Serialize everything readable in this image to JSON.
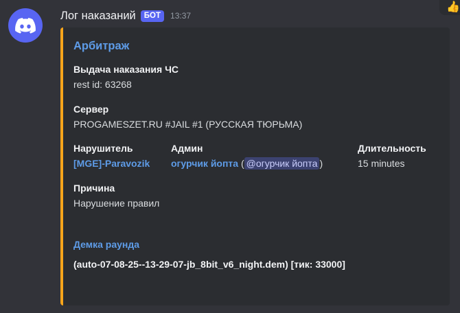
{
  "message": {
    "author": "Лог наказаний",
    "bot_tag": "БОТ",
    "timestamp": "13:37"
  },
  "reaction": {
    "emoji": "👍"
  },
  "embed": {
    "accent_color": "#f8a51b",
    "title": "Арбитраж",
    "fields": {
      "issue": {
        "name": "Выдача наказания ЧС",
        "value": "rest id: 63268"
      },
      "server": {
        "name": "Сервер",
        "value": "PROGAMESZET.RU #JAIL #1 (РУССКАЯ ТЮРЬМА)"
      },
      "violator": {
        "name": "Нарушитель",
        "value": "[MGE]-Paravozik"
      },
      "admin": {
        "name": "Админ",
        "value": "огурчик йопта",
        "open_paren": "(",
        "mention": "@огурчик йопта",
        "close_paren": ")"
      },
      "duration": {
        "name": "Длительность",
        "value": "15 minutes"
      },
      "reason": {
        "name": "Причина",
        "value": "Нарушение правил"
      },
      "demo": {
        "name": "Демка раунда",
        "value": "(auto-07-08-25--13-29-07-jb_8bit_v6_night.dem) [тик: 33000]"
      }
    }
  }
}
